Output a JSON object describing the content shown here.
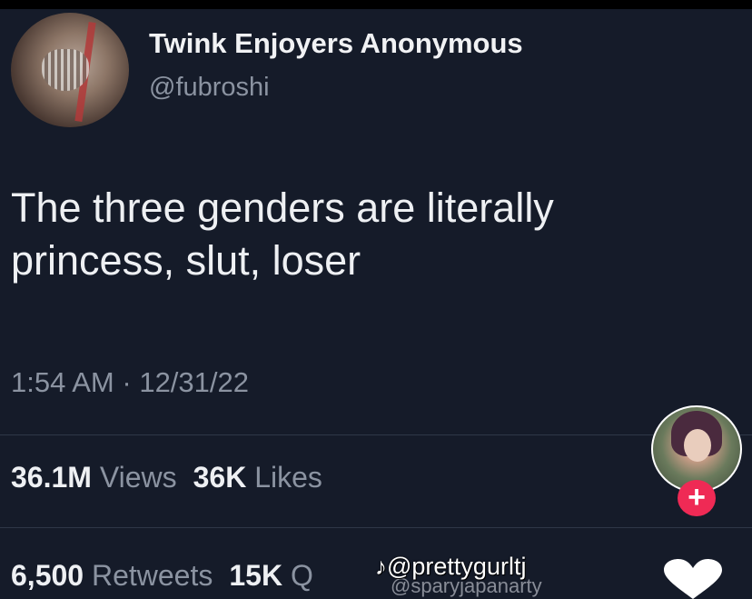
{
  "author": {
    "display_name": "Twink Enjoyers Anonymous",
    "handle": "@fubroshi"
  },
  "tweet": {
    "line1": "The three genders are literally",
    "line2": "princess, slut, loser"
  },
  "meta": {
    "time": "1:54 AM",
    "separator": "·",
    "date": "12/31/22"
  },
  "stats": {
    "views_count": "36.1M",
    "views_label": "Views",
    "likes_count": "36K",
    "likes_label": "Likes",
    "retweets_count": "6,500",
    "retweets_label": "Retweets",
    "quotes_count": "15K",
    "quotes_label": "Q"
  },
  "overlay": {
    "follow_button": "+",
    "watermark_logo": "♪",
    "watermark_user": "@prettygurltj",
    "watermark_user2": "@sparyjapanarty"
  },
  "colors": {
    "background": "#151b29",
    "text_primary": "#eef0f3",
    "text_secondary": "#8b93a1",
    "follow_accent": "#ef2a55"
  }
}
